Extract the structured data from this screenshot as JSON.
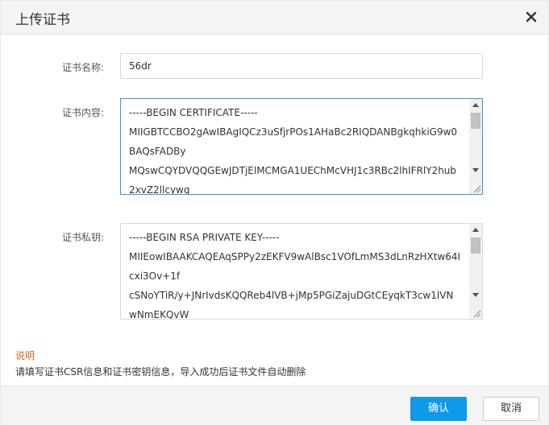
{
  "dialog": {
    "title": "上传证书",
    "close_icon": "close-icon"
  },
  "form": {
    "name_label": "证书名称:",
    "name_value": "56dr",
    "content_label": "证书内容:",
    "content_value": "-----BEGIN CERTIFICATE-----\nMIIGBTCCBO2gAwIBAgIQCz3uSfjrPOs1AHaBc2RIQDANBgkqhkiG9w0BAQsFADBy\nMQswCQYDVQQGEwJDTjElMCMGA1UEChMcVHJ1c3RBc2lhIFRlY2hub2xvZ2llcywg",
    "key_label": "证书私钥:",
    "key_value": "-----BEGIN RSA PRIVATE KEY-----\nMIIEowIBAAKCAQEAqSPPy2zEKFV9wAlBsc1VOfLmMS3dLnRzHXtw64Icxi3Ov+1f\ncSNoYTiR/y+JNrIvdsKQQReb4lVB+jMp5PGiZajuDGtCEyqkT3cw1lVNwNmEKQvW"
  },
  "note": {
    "title": "说明",
    "text": "请填写证书CSR信息和证书密钥信息，导入成功后证书文件自动删除"
  },
  "footer": {
    "confirm_label": "确认",
    "cancel_label": "取消"
  },
  "colors": {
    "accent": "#0e9ae9",
    "focus_border": "#3399dd",
    "note_title": "#e0601e"
  }
}
